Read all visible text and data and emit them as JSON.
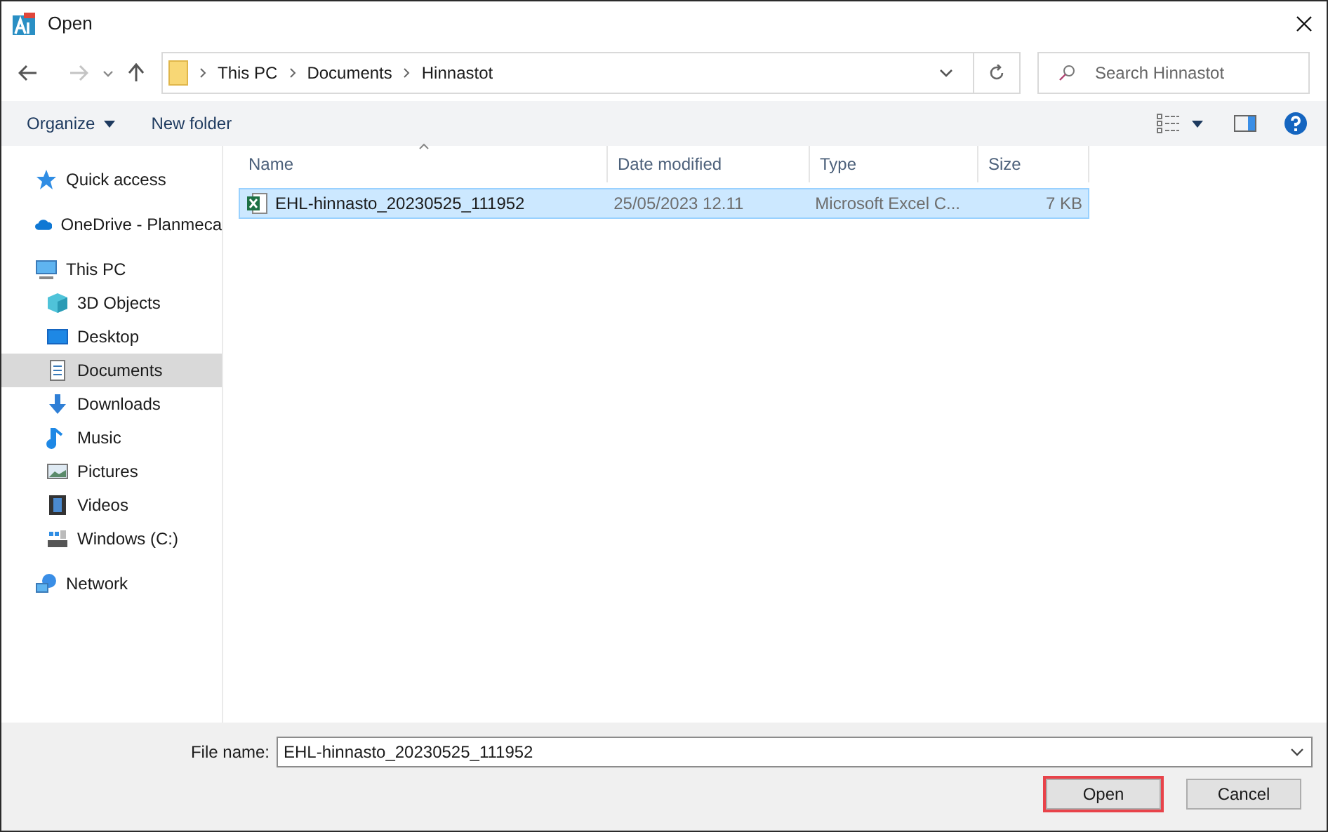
{
  "window": {
    "title": "Open"
  },
  "address": {
    "crumbs": [
      "This PC",
      "Documents",
      "Hinnastot"
    ]
  },
  "search": {
    "placeholder": "Search Hinnastot"
  },
  "toolbar": {
    "organize": "Organize",
    "new_folder": "New folder"
  },
  "sidebar": {
    "items": [
      {
        "label": "Quick access",
        "kind": "star",
        "selected": false
      },
      {
        "label": "OneDrive - Planmeca",
        "kind": "cloud",
        "selected": false
      },
      {
        "label": "This PC",
        "kind": "pc",
        "selected": false,
        "children": [
          {
            "label": "3D Objects",
            "kind": "cube",
            "selected": false
          },
          {
            "label": "Desktop",
            "kind": "desktop",
            "selected": false
          },
          {
            "label": "Documents",
            "kind": "doc",
            "selected": true
          },
          {
            "label": "Downloads",
            "kind": "download",
            "selected": false
          },
          {
            "label": "Music",
            "kind": "music",
            "selected": false
          },
          {
            "label": "Pictures",
            "kind": "pictures",
            "selected": false
          },
          {
            "label": "Videos",
            "kind": "videos",
            "selected": false
          },
          {
            "label": "Windows (C:)",
            "kind": "drive",
            "selected": false
          }
        ]
      },
      {
        "label": "Network",
        "kind": "network",
        "selected": false
      }
    ]
  },
  "table": {
    "columns": [
      "Name",
      "Date modified",
      "Type",
      "Size"
    ],
    "rows": [
      {
        "cells": [
          "EHL-hinnasto_20230525_111952",
          "25/05/2023 12.11",
          "Microsoft Excel C...",
          "7 KB"
        ],
        "selected": true
      }
    ]
  },
  "file_name": {
    "label": "File name:",
    "value": "EHL-hinnasto_20230525_111952"
  },
  "buttons": [
    {
      "label": "Open",
      "highlighted": true
    },
    {
      "label": "Cancel",
      "highlighted": false
    }
  ]
}
